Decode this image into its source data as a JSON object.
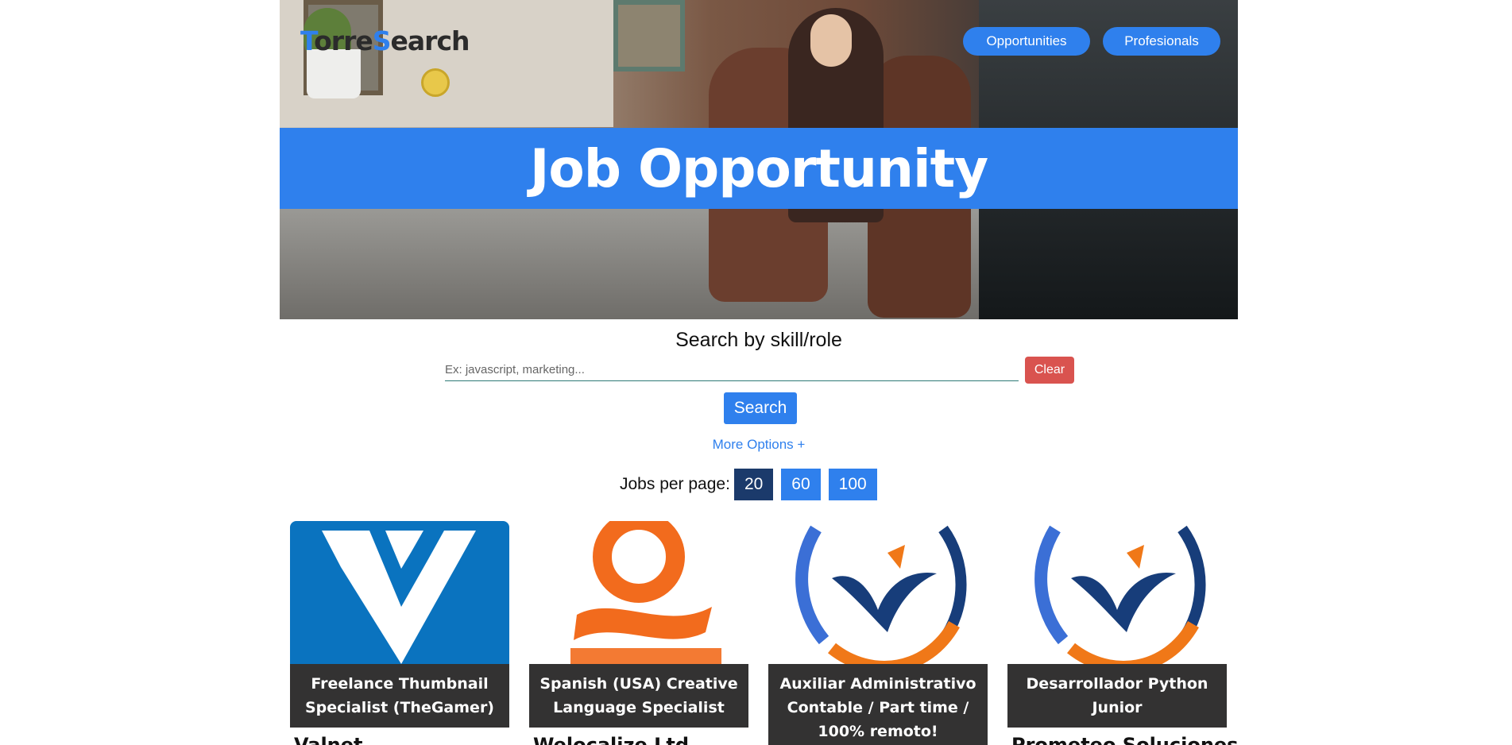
{
  "header": {
    "logo_letter_t": "T",
    "logo_part1": "orre",
    "logo_letter_s": "S",
    "logo_part2": "earch",
    "nav": {
      "opportunities": "Opportunities",
      "profesionals": "Profesionals"
    },
    "banner_title": "Job Opportunity"
  },
  "search": {
    "title": "Search by skill/role",
    "placeholder": "Ex: javascript, marketing...",
    "value": "",
    "clear_label": "Clear",
    "search_label": "Search",
    "more_options_label": "More Options +"
  },
  "pagination": {
    "label": "Jobs per page:",
    "options": [
      "20",
      "60",
      "100"
    ],
    "selected": "20"
  },
  "jobs": [
    {
      "title": "Freelance Thumbnail Specialist (TheGamer)",
      "company": "Valnet"
    },
    {
      "title": "Spanish (USA) Creative Language Specialist",
      "company": "Welocalize Ltd"
    },
    {
      "title": "Auxiliar Administrativo Contable / Part time / 100% remoto!",
      "company": ""
    },
    {
      "title": "Desarrollador Python Junior",
      "company": "Prometeo Soluciones"
    }
  ],
  "logos": {
    "card1": "valnet-logo",
    "card2": "welocalize-logo",
    "card3": "prometeo-logo",
    "card4": "prometeo-logo"
  },
  "colors": {
    "primary": "#2f80ed",
    "active_page": "#1b3a6b",
    "danger": "#d9534f",
    "card_title_bg": "#333232"
  }
}
